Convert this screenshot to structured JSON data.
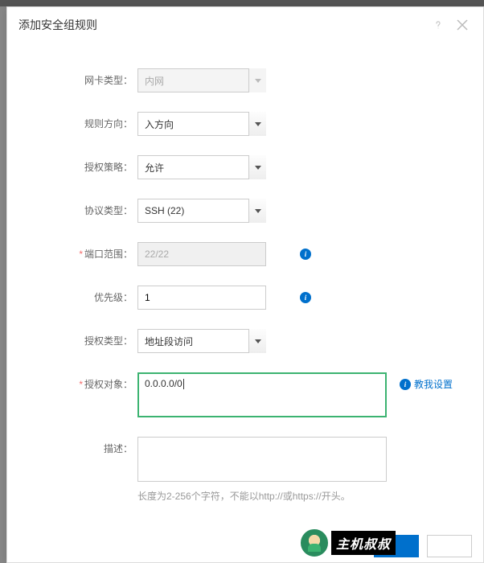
{
  "modal": {
    "title": "添加安全组规则"
  },
  "form": {
    "nic_type": {
      "label": "网卡类型：",
      "value": "内网"
    },
    "direction": {
      "label": "规则方向：",
      "value": "入方向"
    },
    "policy": {
      "label": "授权策略：",
      "value": "允许"
    },
    "protocol": {
      "label": "协议类型：",
      "value": "SSH (22)"
    },
    "port_range": {
      "label": "端口范围：",
      "value": "22/22",
      "required": true
    },
    "priority": {
      "label": "优先级：",
      "value": "1"
    },
    "auth_type": {
      "label": "授权类型：",
      "value": "地址段访问"
    },
    "auth_object": {
      "label": "授权对象：",
      "value": "0.0.0.0/0",
      "required": true,
      "help_link": "教我设置"
    },
    "description": {
      "label": "描述：",
      "hint": "长度为2-256个字符，不能以http://或https://开头。"
    }
  },
  "watermark": "主机叔叔"
}
